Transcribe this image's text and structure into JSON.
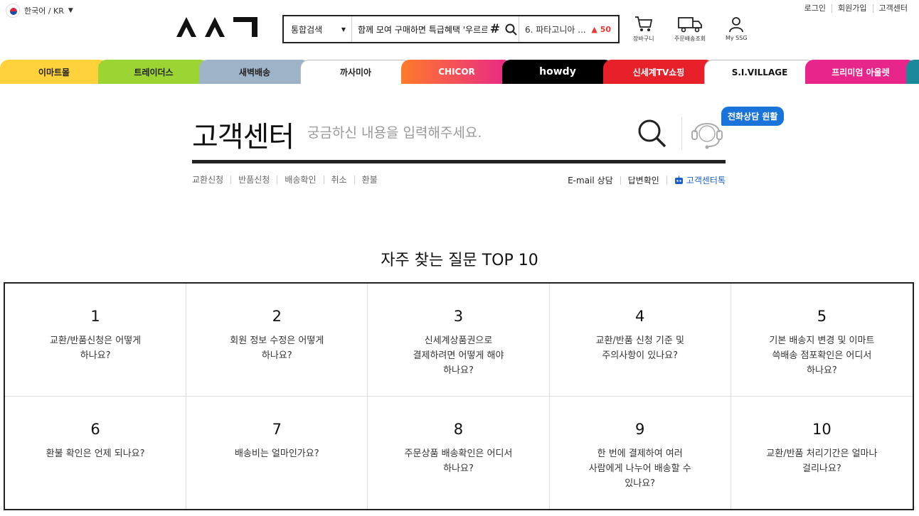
{
  "topbar": {
    "language": "한국어 / KR",
    "links": [
      "로그인",
      "회원가입",
      "고객센터"
    ]
  },
  "header": {
    "logo_text": "SSG",
    "search": {
      "scope": "통합검색",
      "query": "함께 모여 구매하면 특급혜택 '우르르'",
      "hash": "#",
      "ranking_item": "6. 파타고니아 ...",
      "ranking_change": "50"
    },
    "tools": [
      {
        "label": "장바구니",
        "icon": "cart-icon"
      },
      {
        "label": "주문배송조회",
        "icon": "truck-icon"
      },
      {
        "label": "My SSG",
        "icon": "user-icon"
      }
    ]
  },
  "malls": [
    {
      "label": "이마트몰",
      "bg": "#ffd23c",
      "fg": "#222"
    },
    {
      "label": "트레이더스",
      "bg": "#9bd433",
      "fg": "#222"
    },
    {
      "label": "새벽배송",
      "bg": "#9fb3c8",
      "fg": "#222"
    },
    {
      "label": "까사미아",
      "bg": "#ffffff",
      "fg": "#222"
    },
    {
      "label": "CHICOR",
      "bg": "#ff5a3c",
      "fg": "#fff"
    },
    {
      "label": "howdy",
      "bg": "#000000",
      "fg": "#fff"
    },
    {
      "label": "신세계TV쇼핑",
      "bg": "#e8202a",
      "fg": "#fff"
    },
    {
      "label": "S.I.VILLAGE",
      "bg": "#ffffff",
      "fg": "#111"
    },
    {
      "label": "프리미엄 아울렛",
      "bg": "#e8258a",
      "fg": "#fff"
    }
  ],
  "customer_center": {
    "title": "고객센터",
    "placeholder": "궁금하신 내용을 입력해주세요.",
    "phone_badge": "전화상담 원활",
    "sublinks": [
      "교환신청",
      "반품신청",
      "배송확인",
      "취소",
      "환불"
    ],
    "sidelinks": [
      "E-mail 상담",
      "답변확인"
    ],
    "talk_link": "고객센터톡"
  },
  "faq": {
    "title": "자주 찾는 질문 TOP 10",
    "items": [
      {
        "num": "1",
        "q": "교환/반품신청은 어떻게 하나요?"
      },
      {
        "num": "2",
        "q": "회원 정보 수정은 어떻게 하나요?"
      },
      {
        "num": "3",
        "q": "신세계상품권으로 결제하려면 어떻게 해야 하나요?"
      },
      {
        "num": "4",
        "q": "교환/반품 신청 기준 및 주의사항이 있나요?"
      },
      {
        "num": "5",
        "q": "기본 배송지 변경 및 이마트 쓱배송 점포확인은 어디서 하나요?"
      },
      {
        "num": "6",
        "q": "환불 확인은 언제 되나요?"
      },
      {
        "num": "7",
        "q": "배송비는 얼마인가요?"
      },
      {
        "num": "8",
        "q": "주문상품 배송확인은 어디서 하나요?"
      },
      {
        "num": "9",
        "q": "한 번에 결제하여 여러 사람에게 나누어 배송할 수 있나요?"
      },
      {
        "num": "10",
        "q": "교환/반품 처리기간은 얼마나 걸리나요?"
      }
    ]
  }
}
